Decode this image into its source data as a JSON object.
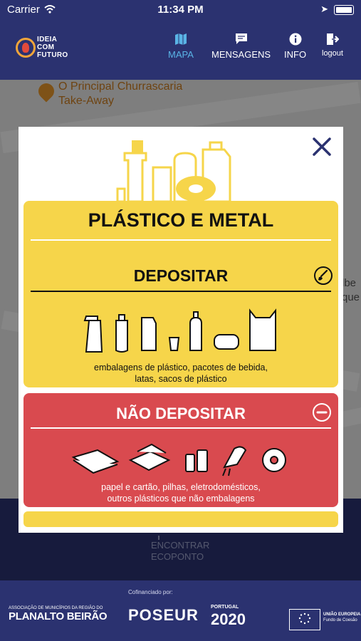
{
  "status_bar": {
    "carrier": "Carrier",
    "time": "11:34 PM"
  },
  "header": {
    "logo_lines": [
      "IDEIA",
      "COM",
      "FUTURO"
    ],
    "nav": [
      {
        "label": "MAPA",
        "icon": "map-icon",
        "active": true
      },
      {
        "label": "MENSAGENS",
        "icon": "message-icon",
        "active": false
      },
      {
        "label": "INFO",
        "icon": "info-icon",
        "active": false
      },
      {
        "label": "logout",
        "icon": "logout-icon",
        "active": false
      }
    ]
  },
  "map": {
    "place_name": "O Principal Churrascaria",
    "place_subtitle": "Take-Away",
    "edge_text_1": "lbe",
    "edge_text_2": "que"
  },
  "modal": {
    "title": "PLÁSTICO E METAL",
    "deposit": {
      "heading": "DEPOSITAR",
      "caption_line1": "embalagens de plástico, pacotes de bebida,",
      "caption_line2": "latas, sacos de plástico"
    },
    "no_deposit": {
      "heading": "NÃO DEPOSITAR",
      "caption_line1": "papel e cartão, pilhas, eletrodomésticos,",
      "caption_line2": "outros plásticos que não embalagens"
    }
  },
  "bottom": {
    "find_line1": "ENCONTRAR",
    "find_line2": "ECOPONTO"
  },
  "footer": {
    "cofinanced": "Cofinanciado por:",
    "planalto_small": "ASSOCIAÇÃO DE MUNICÍPIOS DA REGIÃO DO",
    "planalto": "PLANALTO BEIRÃO",
    "poseur": "POSEUR",
    "portugal_small": "PORTUGAL",
    "portugal": "2020",
    "eu_line1": "UNIÃO EUROPEIA",
    "eu_line2": "Fundo de Coesão"
  },
  "colors": {
    "navy": "#2b3270",
    "yellow": "#f6d54a",
    "red": "#d94a4f",
    "active_nav": "#5ab4e6"
  }
}
